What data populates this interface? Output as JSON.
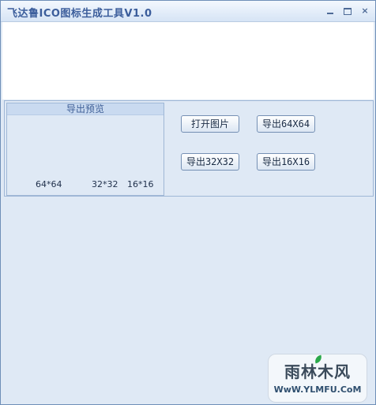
{
  "window": {
    "title": "飞达鲁ICO图标生成工具V1.0",
    "controls": [
      "minimize-icon",
      "maximize-icon",
      "close-icon"
    ],
    "close_glyph": "×"
  },
  "preview": {
    "header": "导出预览",
    "sizes": [
      "64*64",
      "32*32",
      "16*16"
    ]
  },
  "buttons": {
    "open": "打开图片",
    "export_64": "导出64X64",
    "export_32": "导出32X32",
    "export_16": "导出16X16"
  },
  "watermark": {
    "logo_text": "雨林木风",
    "url": "WwW.YLMFU.CoM"
  },
  "colors": {
    "title": "#3b5d9b",
    "panel_bg": "#dfe9f5",
    "border": "#9fb7d6"
  }
}
